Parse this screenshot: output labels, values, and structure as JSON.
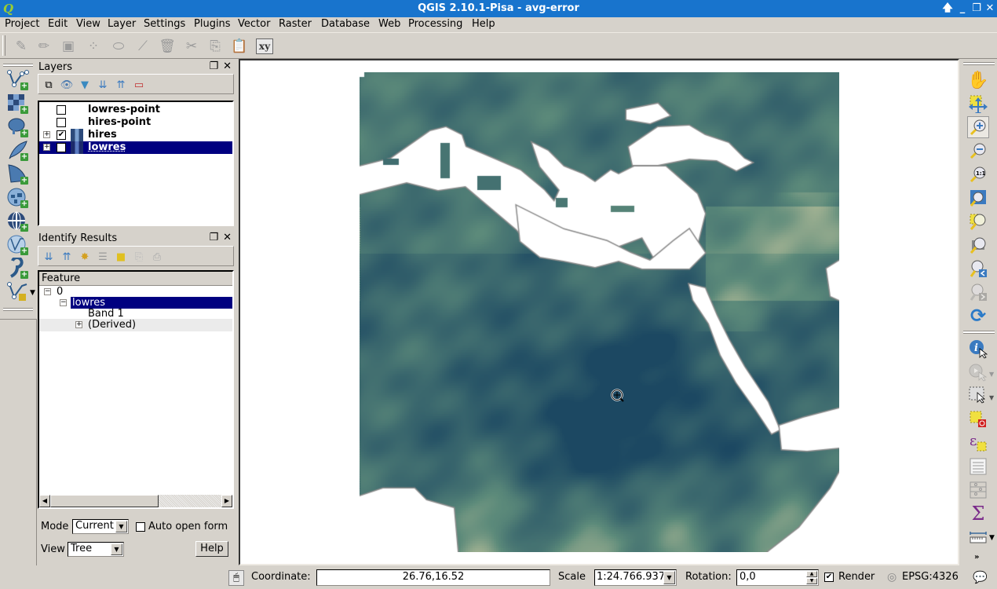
{
  "window": {
    "title": "QGIS 2.10.1-Pisa - avg-error",
    "app_icon": "qgis-logo-icon",
    "controls": [
      "shade-icon",
      "minimize-icon",
      "restore-icon",
      "close-icon"
    ]
  },
  "menubar": {
    "items": [
      "Project",
      "Edit",
      "View",
      "Layer",
      "Settings",
      "Plugins",
      "Vector",
      "Raster",
      "Database",
      "Web",
      "Processing",
      "Help"
    ]
  },
  "toolbar": {
    "digitizing_icons": [
      "current-edits-icon",
      "toggle-editing-icon",
      "save-edits-icon",
      "add-feature-icon",
      "move-feature-icon",
      "node-tool-icon",
      "delete-selected-icon",
      "cut-features-icon",
      "copy-features-icon",
      "paste-features-icon",
      "xy-coordinates-icon"
    ],
    "xy_label": "xy"
  },
  "left_toolbar": {
    "icons": [
      "add-vector-layer-icon",
      "add-raster-layer-icon",
      "add-postgis-layer-icon",
      "add-spatialite-layer-icon",
      "add-mssql-layer-icon",
      "add-wms-layer-icon",
      "add-wcs-layer-icon",
      "add-wfs-layer-icon",
      "add-delimited-text-layer-icon",
      "new-shapefile-layer-icon"
    ]
  },
  "layers_panel": {
    "title": "Layers",
    "toolbar_icons": [
      "add-group-icon",
      "manage-visibility-icon",
      "filter-legend-icon",
      "expand-all-icon",
      "collapse-all-icon",
      "remove-layer-icon"
    ],
    "layers": [
      {
        "name": "lowres-point",
        "checked": false,
        "expandable": false,
        "selected": false
      },
      {
        "name": "hires-point",
        "checked": false,
        "expandable": false,
        "selected": false
      },
      {
        "name": "hires",
        "checked": true,
        "expandable": true,
        "selected": false
      },
      {
        "name": "lowres",
        "checked": true,
        "expandable": true,
        "selected": true
      }
    ]
  },
  "identify_panel": {
    "title": "Identify Results",
    "toolbar_icons": [
      "expand-tree-icon",
      "collapse-tree-icon",
      "expand-new-results-icon",
      "clear-results-icon",
      "clear-highlights-icon",
      "copy-feature-icon",
      "print-icon"
    ],
    "column_header": "Feature",
    "tree": [
      {
        "label": "0",
        "level": 0,
        "expander": "-",
        "selected": false
      },
      {
        "label": "lowres",
        "level": 1,
        "expander": "-",
        "selected": true
      },
      {
        "label": "Band 1",
        "level": 2,
        "expander": "",
        "selected": false
      },
      {
        "label": "(Derived)",
        "level": 2,
        "expander": "+",
        "selected": false
      }
    ],
    "mode_label": "Mode",
    "mode_value": "Current",
    "auto_open_form_label": "Auto open form",
    "auto_open_form_checked": false,
    "view_label": "View",
    "view_value": "Tree",
    "help_label": "Help"
  },
  "map": {
    "layer": "lowres",
    "colors": {
      "low": "#1c4862",
      "mid": "#5c8a7a",
      "high": "#c8c8a0",
      "peak": "#d87060",
      "nodata": "#ffffff",
      "edge": "#8a8a8a"
    },
    "cursor": "identify-crosshair-icon"
  },
  "right_toolbar": {
    "icons": [
      "pan-map-icon",
      "pan-to-selection-icon",
      "zoom-in-icon",
      "zoom-out-icon",
      "zoom-actual-size-icon",
      "zoom-full-icon",
      "zoom-to-selection-icon",
      "zoom-to-layer-icon",
      "zoom-last-icon",
      "zoom-next-icon",
      "refresh-icon",
      "identify-features-icon",
      "run-feature-action-icon",
      "select-features-icon",
      "deselect-all-icon",
      "select-by-expression-icon",
      "open-attribute-table-icon",
      "field-calculator-icon",
      "statistical-summary-icon",
      "measure-line-icon",
      "more-tools-icon"
    ]
  },
  "statusbar": {
    "coordinate_label": "Coordinate:",
    "coordinate_value": "26.76,16.52",
    "scale_label": "Scale",
    "scale_value": "1:24.766.937",
    "rotation_label": "Rotation:",
    "rotation_value": "0,0",
    "render_label": "Render",
    "render_checked": true,
    "crs_label": "EPSG:4326"
  }
}
